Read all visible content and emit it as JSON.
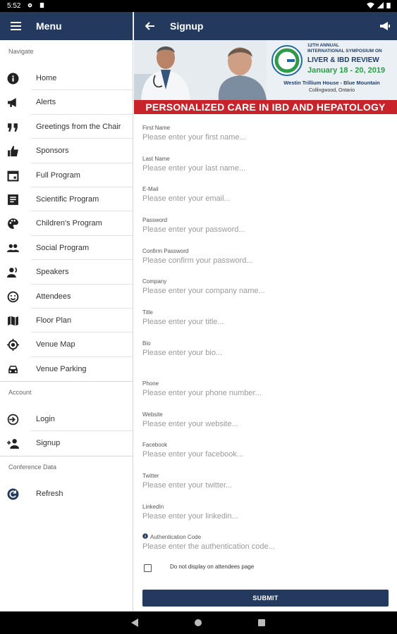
{
  "status": {
    "time": "5:52"
  },
  "drawer": {
    "title": "Menu",
    "sections": [
      {
        "label": "Navigate",
        "items": [
          {
            "label": "Home",
            "icon": "info-icon"
          },
          {
            "label": "Alerts",
            "icon": "megaphone-icon"
          },
          {
            "label": "Greetings from the Chair",
            "icon": "quote-icon"
          },
          {
            "label": "Sponsors",
            "icon": "thumbs-up-icon"
          },
          {
            "label": "Full Program",
            "icon": "calendar-icon"
          },
          {
            "label": "Scientific Program",
            "icon": "document-icon"
          },
          {
            "label": "Children's Program",
            "icon": "palette-icon"
          },
          {
            "label": "Social Program",
            "icon": "people-icon"
          },
          {
            "label": "Speakers",
            "icon": "speakers-icon"
          },
          {
            "label": "Attendees",
            "icon": "smiley-icon"
          },
          {
            "label": "Floor Plan",
            "icon": "map-icon"
          },
          {
            "label": "Venue Map",
            "icon": "location-icon"
          },
          {
            "label": "Venue Parking",
            "icon": "car-icon"
          }
        ]
      },
      {
        "label": "Account",
        "items": [
          {
            "label": "Login",
            "icon": "login-icon"
          },
          {
            "label": "Signup",
            "icon": "add-person-icon"
          }
        ]
      },
      {
        "label": "Conference Data",
        "items": [
          {
            "label": "Refresh",
            "icon": "refresh-icon"
          }
        ]
      }
    ]
  },
  "header": {
    "title": "Signup"
  },
  "banner": {
    "line1": "12TH ANNUAL",
    "line2": "INTERNATIONAL SYMPOSIUM ON",
    "headline": "LIVER & IBD REVIEW",
    "dates": "January 18 - 20, 2019",
    "venue": "Westin Trillium House - Blue Mountain",
    "location": "Collingwood, Ontario",
    "tagline": "PERSONALIZED CARE IN IBD AND HEPATOLOGY"
  },
  "form": {
    "fields": [
      {
        "label": "First Name",
        "placeholder": "Please enter your first name..."
      },
      {
        "label": "Last Name",
        "placeholder": "Please enter your last name..."
      },
      {
        "label": "E-Mail",
        "placeholder": "Please enter your email..."
      },
      {
        "label": "Password",
        "placeholder": "Please enter your password..."
      },
      {
        "label": "Confirm Password",
        "placeholder": "Please confirm your password..."
      },
      {
        "label": "Company",
        "placeholder": "Please enter your company name..."
      },
      {
        "label": "Title",
        "placeholder": "Please enter your title..."
      },
      {
        "label": "Bio",
        "placeholder": "Please enter your bio..."
      },
      {
        "label": "Phone",
        "placeholder": "Please enter your phone number..."
      },
      {
        "label": "Website",
        "placeholder": "Please enter your website..."
      },
      {
        "label": "Facebook",
        "placeholder": "Please enter your facebook..."
      },
      {
        "label": "Twitter",
        "placeholder": "Please enter your twitter..."
      },
      {
        "label": "LinkedIn",
        "placeholder": "Please enter your linkedin..."
      },
      {
        "label": "Authentication Code",
        "placeholder": "Please enter the authentication code..."
      }
    ],
    "checkbox_label": "Do not display on attendees page",
    "submit_label": "SUBMIT"
  },
  "colors": {
    "primary": "#233a5e",
    "banner_red": "#c8222a"
  }
}
